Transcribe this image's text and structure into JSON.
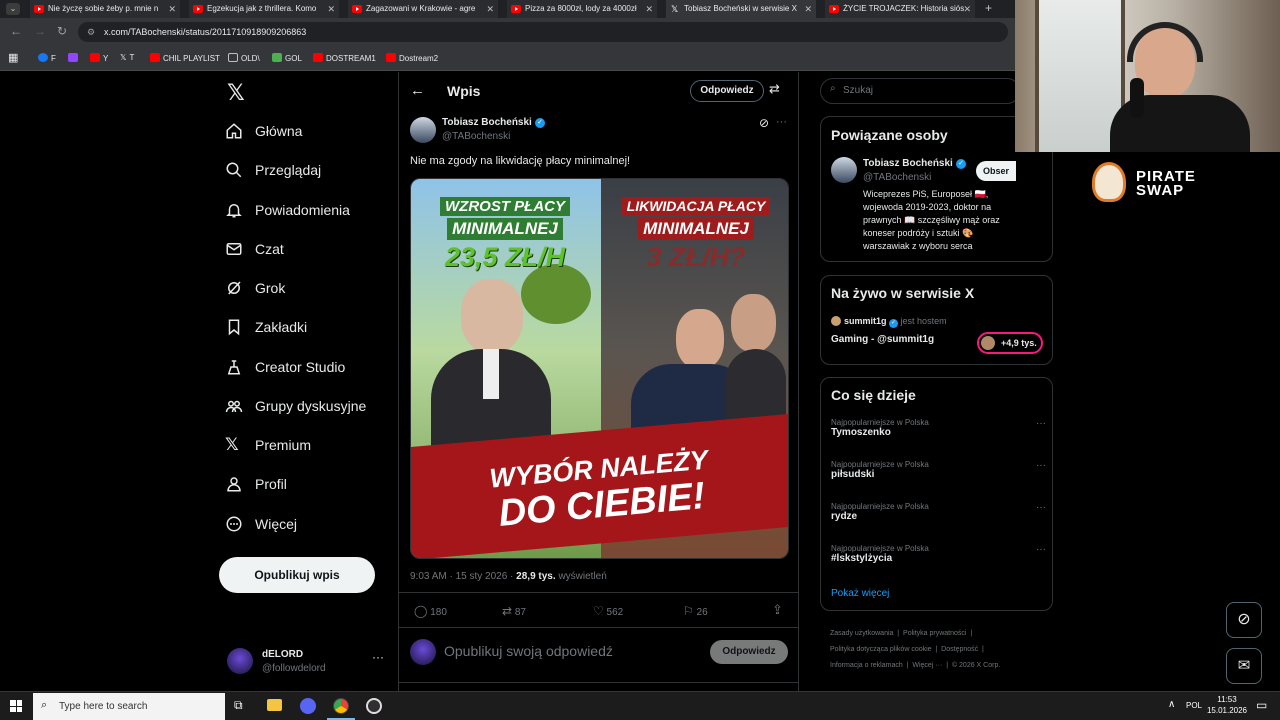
{
  "browser": {
    "tabs": [
      {
        "label": "Nie życzę sobie żeby p. mnie n"
      },
      {
        "label": "Egzekucja jak z thrillera. Komo"
      },
      {
        "label": "Zagazowani w Krakowie - agre"
      },
      {
        "label": "Pizza za 8000zł, lody za 4000zł"
      },
      {
        "label": "Tobiasz Bocheński w serwisie X"
      },
      {
        "label": "ŻYCIE TROJACZEK: Historia siós"
      }
    ],
    "url": "x.com/TABochenski/status/2011710918909206863",
    "bookmarks": [
      "F",
      "Y",
      "T",
      "CHIL PLAYLIST",
      "OLD\\",
      "GOL",
      "DOSTREAM1",
      "Dostream2"
    ]
  },
  "nav": {
    "items": [
      {
        "label": "Główna",
        "icon": "home-icon"
      },
      {
        "label": "Przeglądaj",
        "icon": "search-icon"
      },
      {
        "label": "Powiadomienia",
        "icon": "bell-icon"
      },
      {
        "label": "Czat",
        "icon": "mail-icon"
      },
      {
        "label": "Grok",
        "icon": "grok-icon"
      },
      {
        "label": "Zakładki",
        "icon": "bookmark-icon"
      },
      {
        "label": "Creator Studio",
        "icon": "creator-icon"
      },
      {
        "label": "Grupy dyskusyjne",
        "icon": "community-icon"
      },
      {
        "label": "Premium",
        "icon": "x-icon"
      },
      {
        "label": "Profil",
        "icon": "profile-icon"
      },
      {
        "label": "Więcej",
        "icon": "more-icon"
      }
    ],
    "publish_label": "Opublikuj wpis",
    "account": {
      "name": "dELORD",
      "handle": "@followdelord"
    }
  },
  "header": {
    "title": "Wpis",
    "reply_label": "Odpowiedz"
  },
  "post": {
    "author_name": "Tobiasz Bocheński",
    "author_handle": "@TABochenski",
    "text": "Nie ma zgody na likwidację płacy minimalnej!",
    "image": {
      "left_title_1": "WZROST PŁACY",
      "left_title_2": "MINIMALNEJ",
      "left_value": "23,5 ZŁ/H",
      "right_title_1": "LIKWIDACJA PŁACY",
      "right_title_2": "MINIMALNEJ",
      "right_value": "3 ZŁ/H?",
      "banner_1": "WYBÓR NALEŻY",
      "banner_2": "DO CIEBIE!"
    },
    "time": "9:03 AM · 15 sty 2026 ·",
    "views_count": "28,9 tys.",
    "views_label": "wyświetleń",
    "stats": {
      "replies": "180",
      "reposts": "87",
      "likes": "562",
      "bookmarks": "26"
    },
    "reply_placeholder": "Opublikuj swoją odpowiedź",
    "reply_button": "Odpowiedz"
  },
  "right": {
    "search_placeholder": "Szukaj",
    "related": {
      "title": "Powiązane osoby",
      "name": "Tobiasz Bocheński",
      "handle": "@TABochenski",
      "follow_label": "Obser",
      "bio_1": "Wiceprezes PiS, Europoseł 🇵🇱,",
      "bio_2": "wojewoda 2019-2023, doktor na",
      "bio_3": "prawnych 📖 szczęśliwy mąż oraz",
      "bio_4": "koneser podróży i sztuki 🎨",
      "bio_5": "warszawiak z wyboru serca"
    },
    "live": {
      "title": "Na żywo w serwisie X",
      "host": "summit1g",
      "host_suffix": "jest hostem",
      "stream": "Gaming - @summit1g",
      "listeners": "+4,9 tys."
    },
    "trends": {
      "title": "Co się dzieje",
      "items": [
        {
          "category": "Najpopularniejsze w Polska",
          "name": "Tymoszenko"
        },
        {
          "category": "Najpopularniejsze w Polska",
          "name": "piłsudski"
        },
        {
          "category": "Najpopularniejsze w Polska",
          "name": "rydze"
        },
        {
          "category": "Najpopularniejsze w Polska",
          "name": "#lskstylżycia"
        }
      ],
      "show_more": "Pokaż więcej"
    },
    "footer": {
      "l1": [
        "Zasady użytkowania",
        "Polityka prywatności"
      ],
      "l2": [
        "Polityka dotycząca plików cookie",
        "Dostępność"
      ],
      "l3": [
        "Informacja o reklamach",
        "Więcej ···",
        "© 2026 X Corp."
      ]
    }
  },
  "overlay": {
    "brand_1": "PIRATE",
    "brand_2": "SWAP"
  },
  "taskbar": {
    "search_placeholder": "Type here to search",
    "lang": "POL",
    "time": "11:53",
    "date": "15.01.2026"
  },
  "colors": {
    "accent": "#1d9bf0",
    "verified": "#1d9bf0",
    "bg": "#000000",
    "border": "#2f3336",
    "muted": "#71767b"
  }
}
